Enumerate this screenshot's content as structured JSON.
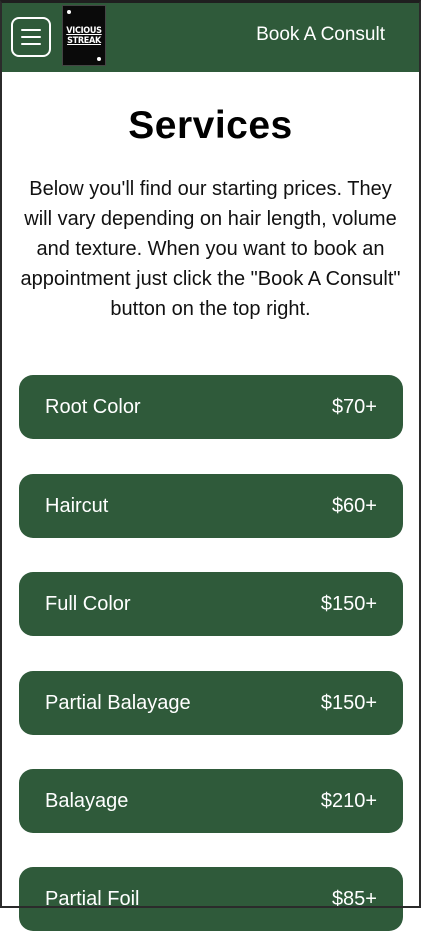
{
  "header": {
    "logo_line1": "VICIOUS",
    "logo_line2": "STREAK",
    "book_label": "Book A Consult"
  },
  "page": {
    "title": "Services",
    "intro": "Below you'll find our starting prices. They will vary depending on hair length, volume and texture. When you want to book an appointment just click the \"Book A Consult\" button on the top right."
  },
  "services": [
    {
      "name": "Root Color",
      "price": "$70+"
    },
    {
      "name": "Haircut",
      "price": "$60+"
    },
    {
      "name": "Full Color",
      "price": "$150+"
    },
    {
      "name": "Partial Balayage",
      "price": "$150+"
    },
    {
      "name": "Balayage",
      "price": "$210+"
    },
    {
      "name": "Partial Foil",
      "price": "$85+"
    }
  ],
  "colors": {
    "brand_green": "#2f5a3a",
    "text": "#000000",
    "background": "#ffffff"
  },
  "icons": {
    "menu": "hamburger-menu-icon",
    "logo": "vicious-streak-logo"
  }
}
